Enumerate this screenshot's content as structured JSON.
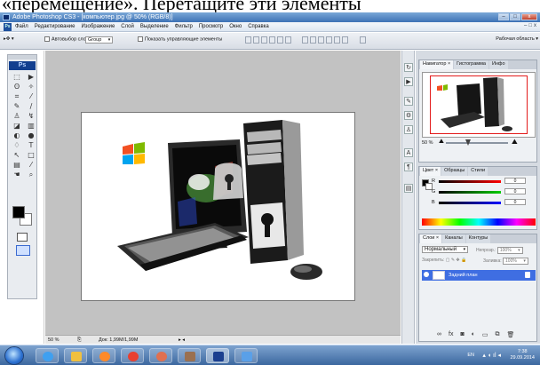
{
  "caption": {
    "text": "«перемещение». Перетащите эти элементы"
  },
  "window": {
    "title": "Adobe Photoshop CS3 - [компьютер.jpg @ 50% (RGB/8)]",
    "controls": [
      "–",
      "□",
      "x"
    ]
  },
  "menu": {
    "items": [
      "Файл",
      "Редактирование",
      "Изображение",
      "Слой",
      "Выделение",
      "Фильтр",
      "Просмотр",
      "Окно",
      "Справка"
    ],
    "mdi": [
      "–",
      "□",
      "x"
    ]
  },
  "options": {
    "autoselect_label": "Автовыбор слоя",
    "autoselect_value": "Group",
    "show_controls_label": "Показать управляющие элементы",
    "workspace_label": "Рабочая область ▾"
  },
  "tools": {
    "logo": "Ps"
  },
  "document": {
    "zoom": "50 %",
    "doc_size": "Док: 1,99М/1,99М"
  },
  "navigator": {
    "tabs": [
      "Навигатор ×",
      "Гистограмма",
      "Инфо"
    ],
    "zoom": "50 %"
  },
  "color": {
    "tabs": [
      "Цвет ×",
      "Образцы",
      "Стили"
    ],
    "channels": [
      {
        "label": "R",
        "value": "0",
        "color": "#e02020"
      },
      {
        "label": "G",
        "value": "0",
        "color": "#20b020"
      },
      {
        "label": "B",
        "value": "0",
        "color": "#2040e0"
      }
    ]
  },
  "layers": {
    "tabs": [
      "Слои ×",
      "Каналы",
      "Контуры"
    ],
    "blend_mode": "Нормальный",
    "opacity_label": "Непрозр.:",
    "opacity_value": "100%",
    "lock_label": "Закрепить:",
    "fill_label": "Заливка:",
    "fill_value": "100%",
    "layer_name": "Задний план"
  },
  "taskbar": {
    "lang": "EN",
    "time": "7:38",
    "date": "29.09.2014",
    "apps": [
      {
        "name": "ie-icon",
        "color": "#3fa0f0"
      },
      {
        "name": "folder-icon",
        "color": "#f0c040"
      },
      {
        "name": "media-icon",
        "color": "#ff8a2a"
      },
      {
        "name": "chrome-icon",
        "color": "#e84030"
      },
      {
        "name": "browser-icon",
        "color": "#e07050"
      },
      {
        "name": "game-icon",
        "color": "#9a7050"
      },
      {
        "name": "photoshop-icon",
        "color": "#1b3f8f"
      },
      {
        "name": "editor-icon",
        "color": "#5aa0e8"
      }
    ]
  }
}
